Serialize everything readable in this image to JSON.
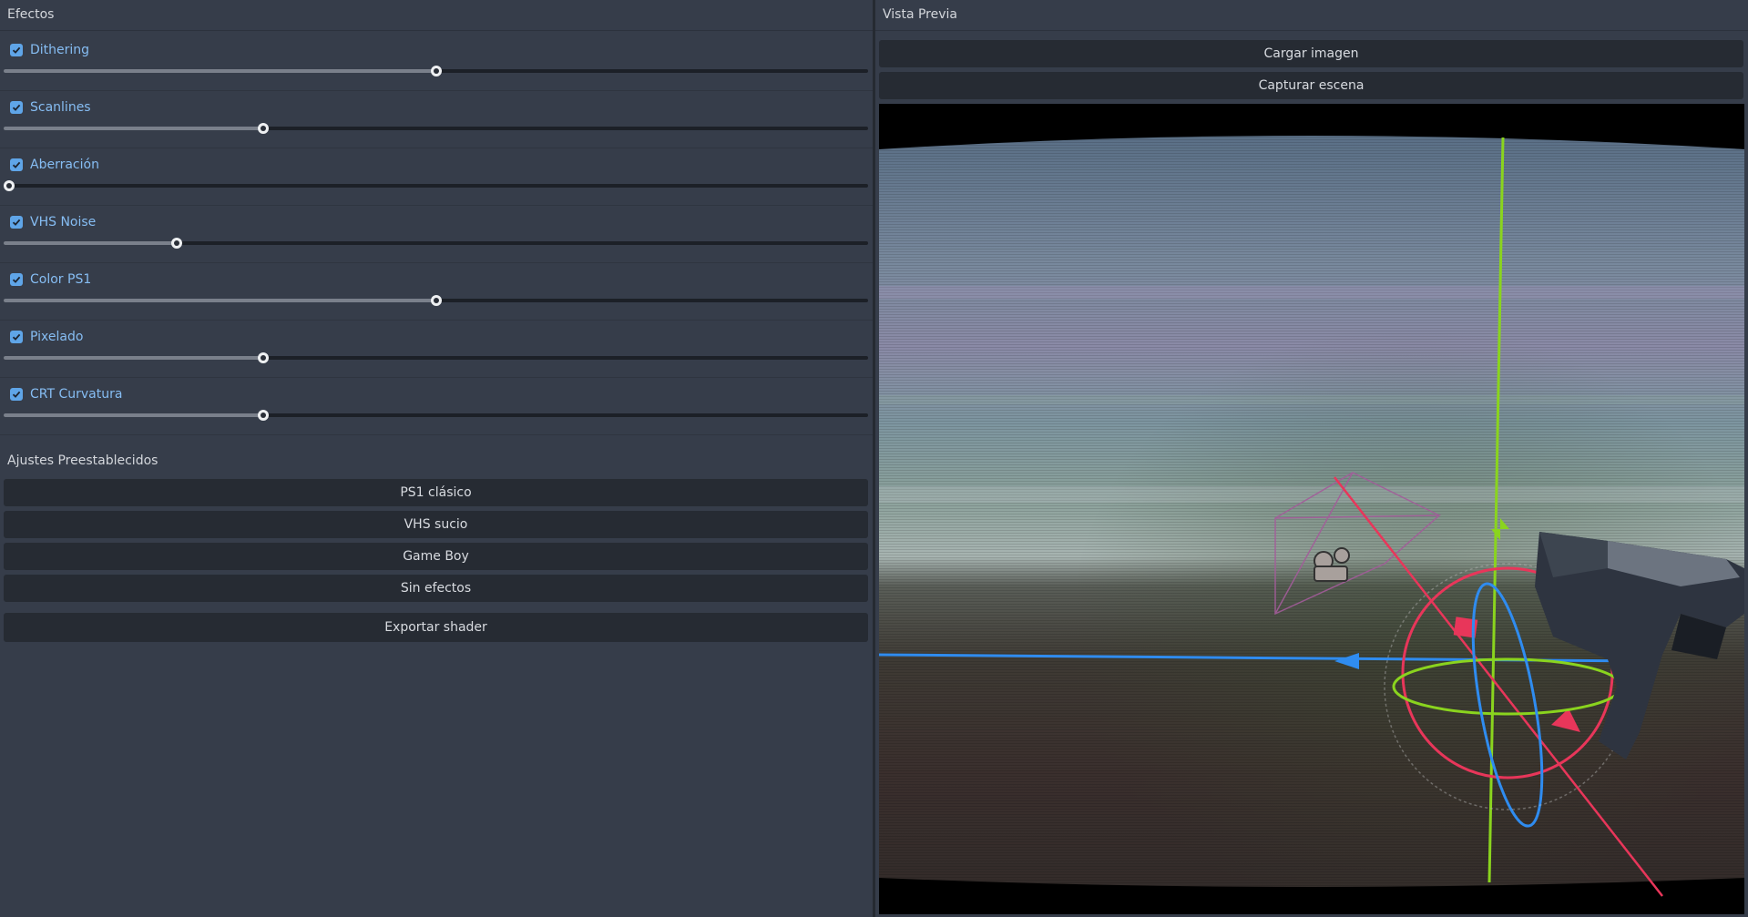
{
  "effects_panel": {
    "title": "Efectos",
    "effects": [
      {
        "label": "Dithering",
        "checked": true,
        "value": 0.5
      },
      {
        "label": "Scanlines",
        "checked": true,
        "value": 0.3
      },
      {
        "label": "Aberración",
        "checked": true,
        "value": 0.0
      },
      {
        "label": "VHS Noise",
        "checked": true,
        "value": 0.2
      },
      {
        "label": "Color PS1",
        "checked": true,
        "value": 0.5
      },
      {
        "label": "Pixelado",
        "checked": true,
        "value": 0.3
      },
      {
        "label": "CRT Curvatura",
        "checked": true,
        "value": 0.3
      }
    ],
    "presets_title": "Ajustes Preestablecidos",
    "presets": [
      "PS1 clásico",
      "VHS sucio",
      "Game Boy",
      "Sin efectos"
    ],
    "export_label": "Exportar shader"
  },
  "preview_panel": {
    "title": "Vista Previa",
    "load_image_label": "Cargar imagen",
    "capture_scene_label": "Capturar escena"
  },
  "colors": {
    "accent": "#5fa5e8",
    "gizmo_x": "#e8365a",
    "gizmo_y": "#8ad41e",
    "gizmo_z": "#2f8cf0"
  }
}
